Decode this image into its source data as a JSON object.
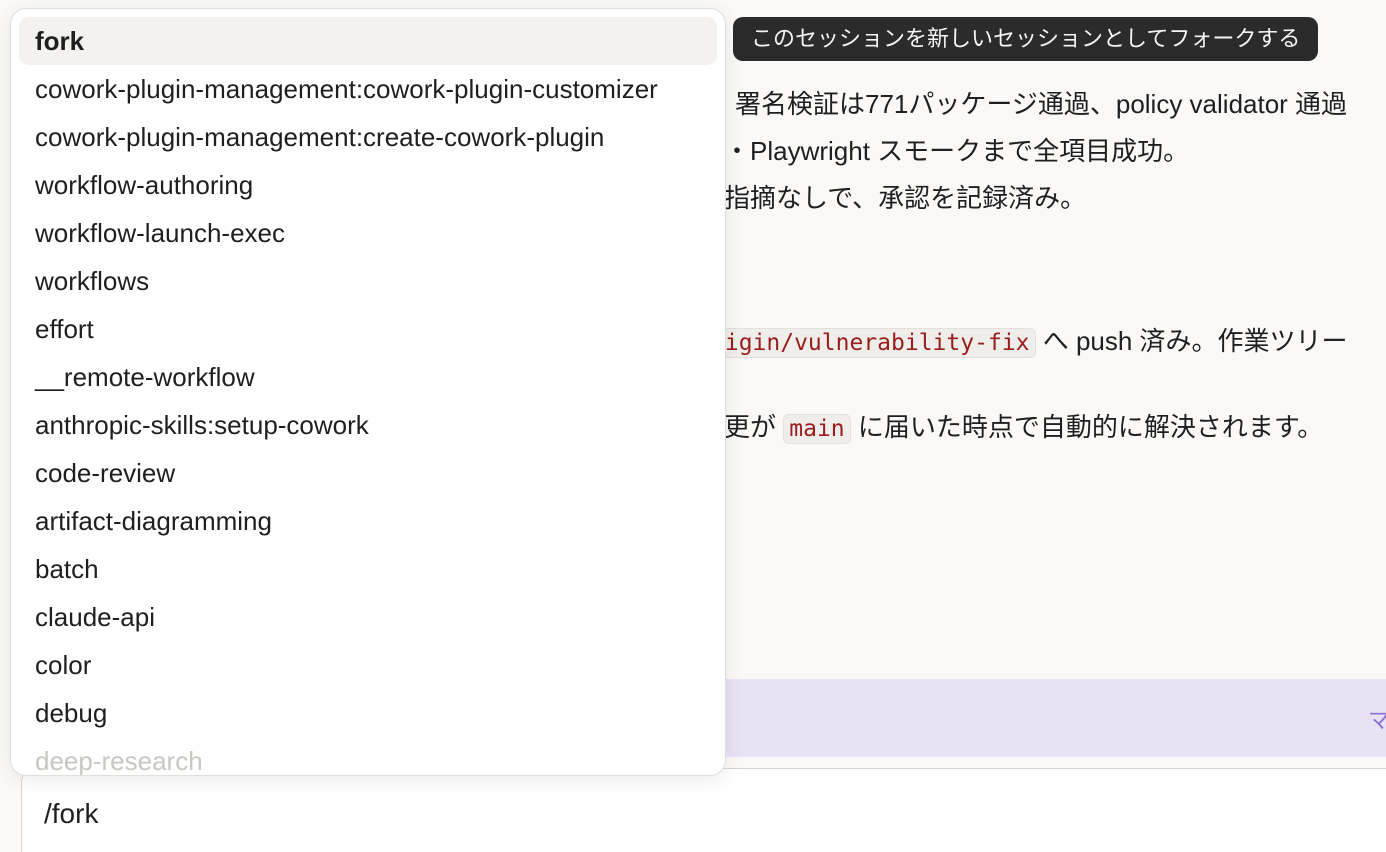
{
  "tooltip": {
    "text": "このセッションを新しいセッションとしてフォークする"
  },
  "conversation": {
    "line1": "署名検証は771パッケージ通過、policy validator 通過",
    "line2": "・Playwright スモークまで全項目成功。",
    "line3": "指摘なしで、承認を記録済み。",
    "line4_code": "rigin/vulnerability-fix",
    "line4_text": "へ push 済み。作業ツリー",
    "line5_pre": "更が",
    "line5_code": "main",
    "line5_post": "に届いた時点で自動的に解決されます。"
  },
  "banner": {
    "text": "マー"
  },
  "command_menu": {
    "items": [
      {
        "label": "fork",
        "selected": true
      },
      {
        "label": "cowork-plugin-management:cowork-plugin-customizer"
      },
      {
        "label": "cowork-plugin-management:create-cowork-plugin"
      },
      {
        "label": "workflow-authoring"
      },
      {
        "label": "workflow-launch-exec"
      },
      {
        "label": "workflows"
      },
      {
        "label": "effort"
      },
      {
        "label": "__remote-workflow"
      },
      {
        "label": "anthropic-skills:setup-cowork"
      },
      {
        "label": "code-review"
      },
      {
        "label": "artifact-diagramming"
      },
      {
        "label": "batch"
      },
      {
        "label": "claude-api"
      },
      {
        "label": "color"
      },
      {
        "label": "debug"
      },
      {
        "label": "deep-research",
        "faded": true
      }
    ]
  },
  "input": {
    "value": "/fork"
  }
}
